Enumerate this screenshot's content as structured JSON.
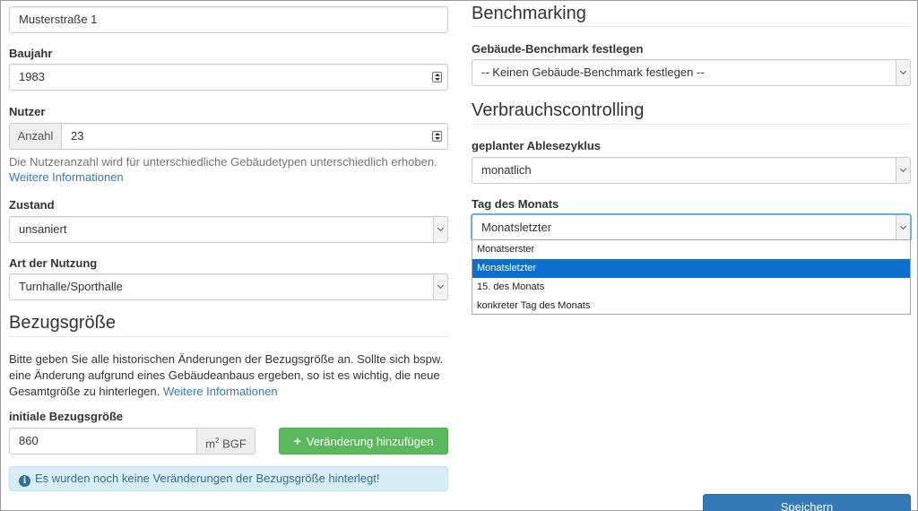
{
  "left": {
    "street_value": "Musterstraße 1",
    "baujahr": {
      "label": "Baujahr",
      "value": "1983"
    },
    "nutzer": {
      "label": "Nutzer",
      "addon": "Anzahl",
      "value": "23",
      "help": "Die Nutzeranzahl wird für unterschiedliche Gebäudetypen unterschiedlich erhoben.",
      "more_link": "Weitere Informationen"
    },
    "zustand": {
      "label": "Zustand",
      "value": "unsaniert"
    },
    "nutzung": {
      "label": "Art der Nutzung",
      "value": "Turnhalle/Sporthalle"
    },
    "bezug": {
      "heading": "Bezugsgröße",
      "text": "Bitte geben Sie alle historischen Änderungen der Bezugsgröße an. Sollte sich bspw. eine Änderung aufgrund eines Gebäudeanbaus ergeben, so ist es wichtig, die neue Gesamtgröße zu hinterlegen.",
      "more_link": "Weitere Informationen",
      "initial_label": "initiale Bezugsgröße",
      "initial_value": "860",
      "unit_base": "m",
      "unit_sup": "2",
      "unit_suffix": " BGF",
      "add_button": "Veränderung hinzufügen",
      "alert": "Es wurden noch keine Veränderungen der Bezugsgröße hinterlegt!"
    }
  },
  "right": {
    "benchmarking": {
      "heading": "Benchmarking",
      "label": "Gebäude-Benchmark festlegen",
      "value": "-- Keinen Gebäude-Benchmark festlegen --"
    },
    "verbrauch": {
      "heading": "Verbrauchscontrolling",
      "zyklus_label": "geplanter Ablesezyklus",
      "zyklus_value": "monatlich",
      "tag_label": "Tag des Monats",
      "tag_value": "Monatsletzter",
      "options": [
        "Monatserster",
        "Monatsletzter",
        "15. des Monats",
        "konkreter Tag des Monats"
      ],
      "selected_index": 1
    },
    "save_button": "Speichern"
  },
  "colors": {
    "success": "#5cb85c",
    "primary": "#337ab7",
    "link": "#337ab7",
    "info_bg": "#d9edf7",
    "dropdown_highlight": "#0a6fce"
  }
}
